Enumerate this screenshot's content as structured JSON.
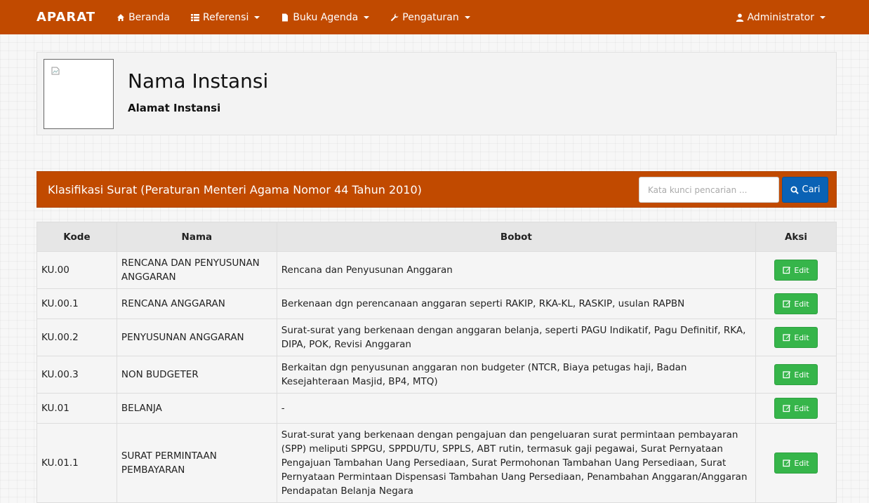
{
  "navbar": {
    "brand": "APARAT",
    "items": [
      {
        "label": "Beranda",
        "icon": "home-icon"
      },
      {
        "label": "Referensi",
        "icon": "list-icon"
      },
      {
        "label": "Buku Agenda",
        "icon": "file-icon"
      },
      {
        "label": "Pengaturan",
        "icon": "wrench-icon"
      }
    ],
    "user": {
      "label": "Administrator",
      "icon": "user-icon"
    },
    "color": "#c14a00"
  },
  "header": {
    "name": "Nama Instansi",
    "address": "Alamat Instansi"
  },
  "section": {
    "title": "Klasifikasi Surat (Peraturan Menteri Agama Nomor 44 Tahun 2010)",
    "search_placeholder": "Kata kunci pencarian ...",
    "search_button": "Cari"
  },
  "table": {
    "headers": [
      "Kode",
      "Nama",
      "Bobot",
      "Aksi"
    ],
    "edit_label": "Edit",
    "rows": [
      {
        "kode": "KU.00",
        "nama": "RENCANA DAN PENYUSUNAN ANGGARAN",
        "bobot": "Rencana dan Penyusunan Anggaran"
      },
      {
        "kode": "KU.00.1",
        "nama": "RENCANA ANGGARAN",
        "bobot": "Berkenaan dgn perencanaan anggaran seperti RAKIP, RKA-KL, RASKIP, usulan RAPBN"
      },
      {
        "kode": "KU.00.2",
        "nama": "PENYUSUNAN ANGGARAN",
        "bobot": "Surat-surat yang berkenaan dengan anggaran belanja, seperti PAGU Indikatif, Pagu Definitif, RKA, DIPA, POK, Revisi Anggaran"
      },
      {
        "kode": "KU.00.3",
        "nama": "NON BUDGETER",
        "bobot": "Berkaitan dgn penyusunan anggaran non budgeter (NTCR, Biaya petugas haji, Badan Kesejahteraan Masjid, BP4, MTQ)"
      },
      {
        "kode": "KU.01",
        "nama": "BELANJA",
        "bobot": "-"
      },
      {
        "kode": "KU.01.1",
        "nama": "SURAT PERMINTAAN PEMBAYARAN",
        "bobot": "Surat-surat yang berkenaan dengan pengajuan dan pengeluaran surat permintaan pembayaran (SPP) meliputi SPPGU, SPPDU/TU, SPPLS, ABT rutin, termasuk gaji pegawai, Surat Pernyataan Pengajuan Tambahan Uang Persediaan, Surat Permohonan Tambahan Uang Persediaan, Surat Pernyataan Permintaan Dispensasi Tambahan Uang Persediaan, Penambahan Anggaran/Anggaran Pendapatan Belanja Negara"
      }
    ]
  }
}
